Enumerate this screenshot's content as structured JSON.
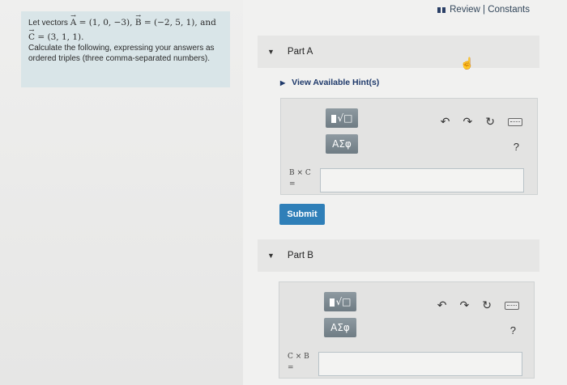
{
  "review": {
    "label": "Review | Constants",
    "icon": "list-icon"
  },
  "problem": {
    "line1_prefix": "Let vectors ",
    "vecA": "A",
    "eqA": " = (1, 0, −3), ",
    "vecB": "B",
    "eqB": " = (−2, 5, 1), and",
    "vecC": "C",
    "eqC": " = (3, 1, 1).",
    "instruction": "Calculate the following, expressing your answers as ordered triples (three comma-separated numbers)."
  },
  "partA": {
    "title": "Part A",
    "hint": "View Available Hint(s)",
    "math_btn": "√□",
    "greek_btn": "ΑΣφ",
    "expr_top": "B × C",
    "expr_eq": "=",
    "answer": "",
    "submit": "Submit"
  },
  "partB": {
    "title": "Part B",
    "math_btn": "√□",
    "greek_btn": "ΑΣφ",
    "expr_top": "C × B",
    "expr_eq": "=",
    "answer": ""
  },
  "toolbar_icons": {
    "undo": "↶",
    "redo": "↷",
    "reset": "↻",
    "help": "?"
  },
  "colors": {
    "accent": "#2f7fb8",
    "problem_bg": "#d9e5e8",
    "tool_btn": "#7b8890"
  }
}
